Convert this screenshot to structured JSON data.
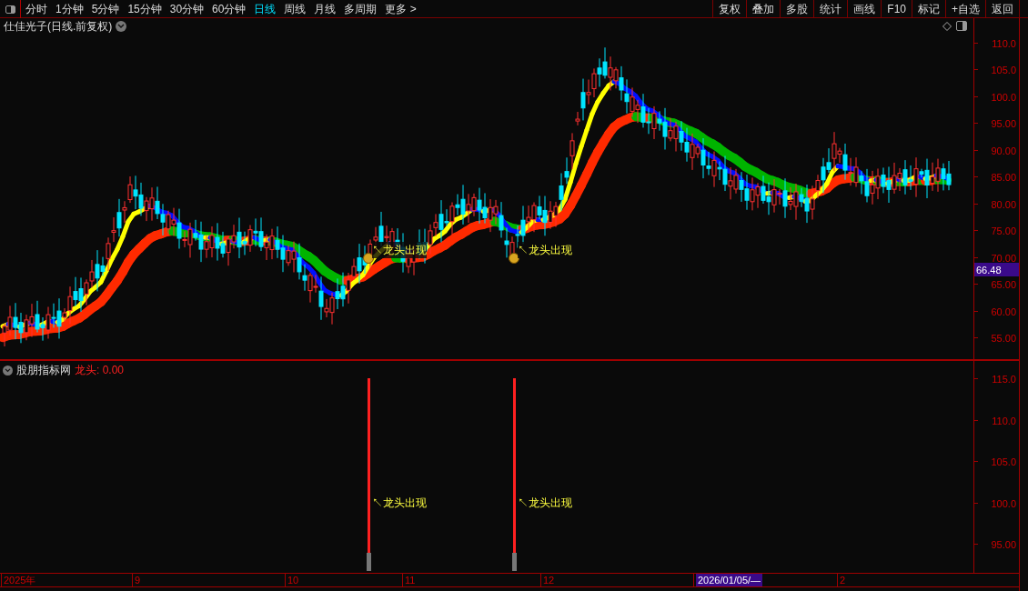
{
  "toolbar": {
    "periods": [
      {
        "label": "分时",
        "selected": false
      },
      {
        "label": "1分钟",
        "selected": false
      },
      {
        "label": "5分钟",
        "selected": false
      },
      {
        "label": "15分钟",
        "selected": false
      },
      {
        "label": "30分钟",
        "selected": false
      },
      {
        "label": "60分钟",
        "selected": false
      },
      {
        "label": "日线",
        "selected": true
      },
      {
        "label": "周线",
        "selected": false
      },
      {
        "label": "月线",
        "selected": false
      },
      {
        "label": "多周期",
        "selected": false
      },
      {
        "label": "更多 >",
        "selected": false
      }
    ],
    "actions": [
      "复权",
      "叠加",
      "多股",
      "统计",
      "画线",
      "F10",
      "标记",
      "+自选",
      "返回"
    ]
  },
  "main_chart": {
    "title": "仕佳光子(日线.前复权)",
    "price_ticks": [
      "110.0",
      "105.0",
      "100.0",
      "95.00",
      "90.00",
      "85.00",
      "80.00",
      "75.00",
      "70.00",
      "65.00",
      "60.00",
      "55.00"
    ],
    "current_price": "66.48",
    "signals": [
      {
        "label": "↖龙头出现"
      },
      {
        "label": "↖龙头出现"
      }
    ]
  },
  "indicator": {
    "name": "股朋指标网",
    "value_label": "龙头: 0.00",
    "ticks": [
      "115.0",
      "110.0",
      "105.0",
      "100.0",
      "95.00"
    ],
    "signals": [
      {
        "label": "↖龙头出现"
      },
      {
        "label": "↖龙头出现"
      }
    ]
  },
  "date_axis": {
    "labels": [
      {
        "label": "2025年",
        "selected": false
      },
      {
        "label": "9",
        "selected": false
      },
      {
        "label": "10",
        "selected": false
      },
      {
        "label": "11",
        "selected": false
      },
      {
        "label": "12",
        "selected": false
      },
      {
        "label": "2026/01/05/—",
        "selected": true
      },
      {
        "label": "2",
        "selected": false
      }
    ]
  }
}
